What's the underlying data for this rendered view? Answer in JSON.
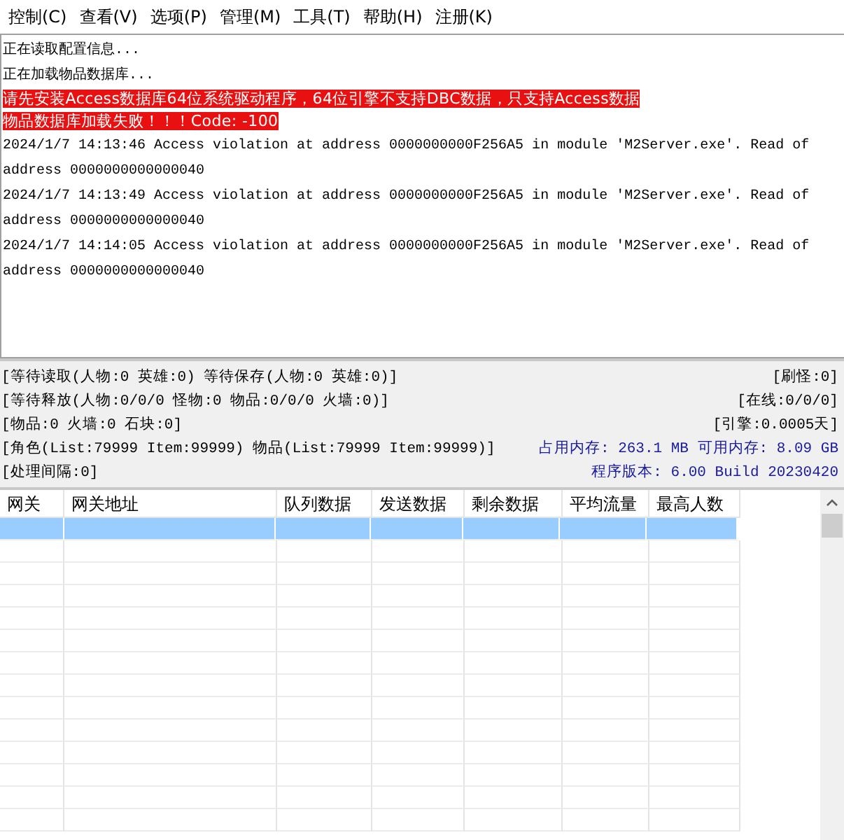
{
  "menu": [
    {
      "label": "控制(C)"
    },
    {
      "label": "查看(V)"
    },
    {
      "label": "选项(P)"
    },
    {
      "label": "管理(M)"
    },
    {
      "label": "工具(T)"
    },
    {
      "label": "帮助(H)"
    },
    {
      "label": "注册(K)"
    }
  ],
  "log": [
    {
      "kind": "info",
      "text": "正在读取配置信息..."
    },
    {
      "kind": "info",
      "text": "正在加载物品数据库..."
    },
    {
      "kind": "error",
      "text": "请先安装Access数据库64位系统驱动程序，64位引擎不支持DBC数据，只支持Access数据"
    },
    {
      "kind": "error",
      "text": "物品数据库加载失败！！！Code: -100"
    },
    {
      "kind": "info",
      "text": "2024/1/7 14:13:46 Access violation at address 0000000000F256A5 in module 'M2Server.exe'. Read of address 0000000000000040"
    },
    {
      "kind": "info",
      "text": "2024/1/7 14:13:49 Access violation at address 0000000000F256A5 in module 'M2Server.exe'. Read of address 0000000000000040"
    },
    {
      "kind": "info",
      "text": "2024/1/7 14:14:05 Access violation at address 0000000000F256A5 in module 'M2Server.exe'. Read of address 0000000000000040"
    }
  ],
  "status": [
    {
      "left": "[等待读取(人物:0 英雄:0) 等待保存(人物:0 英雄:0)]",
      "right": "[刷怪:0]",
      "emphasis": false
    },
    {
      "left": "[等待释放(人物:0/0/0 怪物:0 物品:0/0/0 火墙:0)]",
      "right": "[在线:0/0/0]",
      "emphasis": false
    },
    {
      "left": "[物品:0 火墙:0 石块:0]",
      "right": "[引擎:0.0005天]",
      "emphasis": false
    },
    {
      "left": "[角色(List:79999 Item:99999) 物品(List:79999 Item:99999)]",
      "right": "占用内存: 263.1 MB 可用内存: 8.09 GB",
      "emphasis": true
    },
    {
      "left": "[处理间隔:0]",
      "right": "程序版本: 6.00 Build 20230420",
      "emphasis": true
    }
  ],
  "table": {
    "columns": [
      "网关",
      "网关地址",
      "队列数据",
      "发送数据",
      "剩余数据",
      "平均流量",
      "最高人数"
    ],
    "rows": [
      {
        "selected": true
      },
      {
        "selected": false
      },
      {
        "selected": false
      },
      {
        "selected": false
      },
      {
        "selected": false
      },
      {
        "selected": false
      },
      {
        "selected": false
      },
      {
        "selected": false
      },
      {
        "selected": false
      },
      {
        "selected": false
      },
      {
        "selected": false
      },
      {
        "selected": false
      },
      {
        "selected": false
      },
      {
        "selected": false
      }
    ]
  }
}
